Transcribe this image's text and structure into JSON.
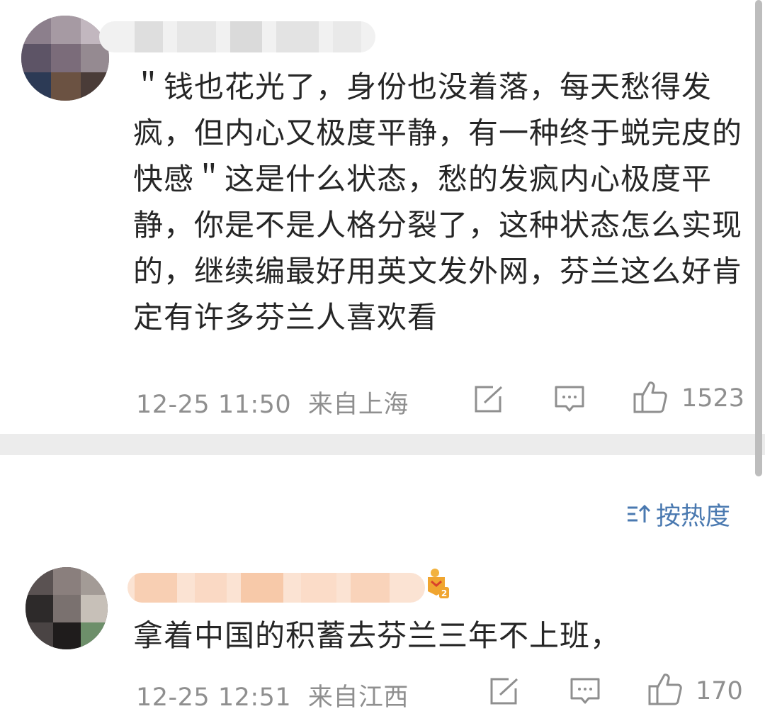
{
  "comments": [
    {
      "text": "＂钱也花光了，身份也没着落，每天愁得发疯，但内心又极度平静，有一种终于蜕完皮的快感＂这是什么状态，愁的发疯内心极度平静，你是不是人格分裂了，这种状态怎么实现的，继续编最好用英文发外网，芬兰这么好肯定有许多芬兰人喜欢看",
      "time": "12-25 11:50",
      "location": "来自上海",
      "likes": "1523"
    },
    {
      "text": "拿着中国的积蓄去芬兰三年不上班，",
      "time": "12-25 12:51",
      "location": "来自江西",
      "likes": "170"
    }
  ],
  "sort": {
    "label": "按热度"
  },
  "icons": {
    "share": "share-icon",
    "reply": "comment-icon",
    "like": "thumbs-up-icon",
    "sort": "sort-icon",
    "badge": "fan-badge-icon"
  },
  "colors": {
    "link": "#4a79b0",
    "meta": "#8f8f8f",
    "divider": "#ececec"
  }
}
